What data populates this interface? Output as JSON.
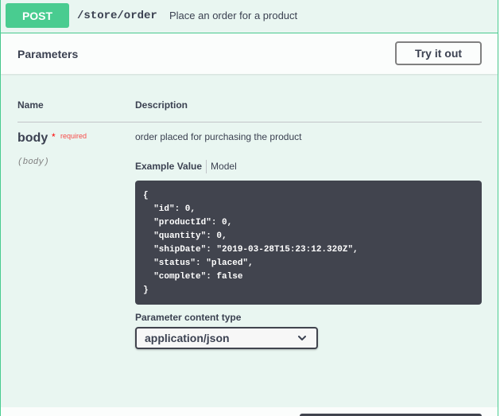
{
  "operation": {
    "method": "POST",
    "path": "/store/order",
    "summary": "Place an order for a product"
  },
  "parameters_section": {
    "title": "Parameters",
    "try_it_out_label": "Try it out",
    "columns": {
      "name": "Name",
      "description": "Description"
    }
  },
  "param": {
    "name": "body",
    "required_star": "*",
    "required_label": "required",
    "location": "(body)",
    "description": "order placed for purchasing the product",
    "tabs": {
      "example_value": "Example Value",
      "model": "Model"
    },
    "example_value": "{\n  \"id\": 0,\n  \"productId\": 0,\n  \"quantity\": 0,\n  \"shipDate\": \"2019-03-28T15:23:12.320Z\",\n  \"status\": \"placed\",\n  \"complete\": false\n}",
    "content_type_label": "Parameter content type",
    "content_type_value": "application/json"
  },
  "colors": {
    "post_green": "#49cc90",
    "post_bg": "#e9f6f1",
    "code_bg": "#41444e",
    "required_red": "#ff0000"
  },
  "icons": {
    "select_chevron": "chevron-down-icon"
  }
}
